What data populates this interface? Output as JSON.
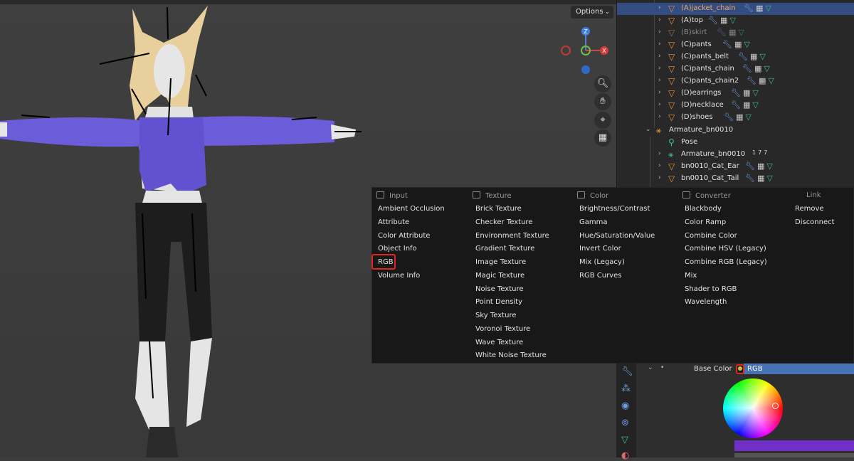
{
  "viewport": {
    "options_label": "Options",
    "gizmo_axes": {
      "z": "Z",
      "x": "X"
    },
    "nav_icons": [
      "zoom-icon",
      "hand-icon",
      "camera-icon",
      "grid-icon"
    ]
  },
  "outliner": {
    "rows": [
      {
        "label": "(A)jacket_chain",
        "selected": true,
        "dim": false
      },
      {
        "label": "(A)top",
        "selected": false,
        "dim": false
      },
      {
        "label": "(B)skirt",
        "selected": false,
        "dim": true
      },
      {
        "label": "(C)pants",
        "selected": false,
        "dim": false
      },
      {
        "label": "(C)pants_belt",
        "selected": false,
        "dim": false
      },
      {
        "label": "(C)pants_chain",
        "selected": false,
        "dim": false
      },
      {
        "label": "(C)pants_chain2",
        "selected": false,
        "dim": false
      },
      {
        "label": "(D)earrings",
        "selected": false,
        "dim": false
      },
      {
        "label": "(D)necklace",
        "selected": false,
        "dim": false
      },
      {
        "label": "(D)shoes",
        "selected": false,
        "dim": false
      },
      {
        "label": "Armature_bn0010",
        "selected": false,
        "dim": false
      },
      {
        "label": "Pose",
        "selected": false,
        "dim": false
      },
      {
        "label": "Armature_bn0010",
        "selected": false,
        "dim": false,
        "badge": "177"
      },
      {
        "label": "bn0010_Cat_Ear",
        "selected": false,
        "dim": false
      },
      {
        "label": "bn0010_Cat_Tail",
        "selected": false,
        "dim": false
      }
    ]
  },
  "menu": {
    "input": {
      "header": "Input",
      "items": [
        "Ambient Occlusion",
        "Attribute",
        "Color Attribute",
        "Object Info",
        "RGB",
        "Volume Info"
      ]
    },
    "texture": {
      "header": "Texture",
      "items": [
        "Brick Texture",
        "Checker Texture",
        "Environment Texture",
        "Gradient Texture",
        "Image Texture",
        "Magic Texture",
        "Noise Texture",
        "Point Density",
        "Sky Texture",
        "Voronoi Texture",
        "Wave Texture",
        "White Noise Texture"
      ]
    },
    "color": {
      "header": "Color",
      "items": [
        "Brightness/Contrast",
        "Gamma",
        "Hue/Saturation/Value",
        "Invert Color",
        "Mix (Legacy)",
        "RGB Curves"
      ]
    },
    "converter": {
      "header": "Converter",
      "items": [
        "Blackbody",
        "Color Ramp",
        "Combine Color",
        "Combine HSV (Legacy)",
        "Combine RGB (Legacy)",
        "Mix",
        "Shader to RGB",
        "Wavelength"
      ]
    },
    "link": {
      "header": "Link",
      "items": [
        "Remove",
        "Disconnect"
      ]
    }
  },
  "properties": {
    "base_color_label": "Base Color",
    "base_color_value": "RGB",
    "color_bar_hex": "#7030c8"
  },
  "colors": {
    "accent": "#4772b3",
    "highlight": "#e0261f",
    "mesh_icon": "#e8923a",
    "modifier_icon": "#6d9de0",
    "data_icon": "#3fbf8a"
  }
}
